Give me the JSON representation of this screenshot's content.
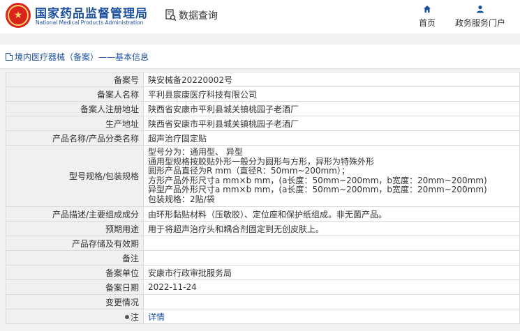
{
  "header": {
    "org_cn": "国家药品监督管理局",
    "org_en": "National Medical Products Administration",
    "query_label": "数据查询",
    "nav": [
      {
        "label": "首页",
        "icon": "home-icon"
      },
      {
        "label": "政务服务门户",
        "icon": "user-icon"
      }
    ]
  },
  "breadcrumb": "境内医疗器械（备案）——基本信息",
  "colors": {
    "brand": "#1b4f9c",
    "logo_red": "#d9231c"
  },
  "rows": [
    {
      "label": "备案号",
      "value": "陕安械备20220002号"
    },
    {
      "label": "备案人名称",
      "value": "平利县宸康医疗科技有限公司"
    },
    {
      "label": "备案人注册地址",
      "value": "陕西省安康市平利县城关镇桃园子老酒厂"
    },
    {
      "label": "生产地址",
      "value": "陕西省安康市平利县城关镇桃园子老酒厂"
    },
    {
      "label": "产品名称/产品分类名称",
      "value": "超声治疗固定贴"
    },
    {
      "label": "型号规格/包装规格",
      "lines": [
        "型号分为：通用型、 异型",
        "通用型规格按胶贴外形一般分为圆形与方形，异形为特殊外形",
        "圆形产品直径为R mm（直径R：50mm~200mm）；",
        "方形产品外形尺寸a mm×b mm，(a长度：50mm~200mm，b宽度：20mm~200mm)",
        "异型产品外形尺寸a mm×b mm，(a长度：50mm~200mm，b宽度：20mm~200mm)",
        "包装规格：2贴/袋"
      ]
    },
    {
      "label": "产品描述/主要组成成分",
      "value": "由环形黏贴材料（压敏胶）、定位座和保护纸组成。非无菌产品。"
    },
    {
      "label": "预期用途",
      "value": "用于将超声治疗头和耦合剂固定到无创皮肤上。"
    },
    {
      "label": "产品存储及有效期",
      "value": ""
    },
    {
      "label": "备注",
      "value": ""
    },
    {
      "label": "备案单位",
      "value": "安康市行政审批服务局"
    },
    {
      "label": "备案日期",
      "value": "2022-11-24"
    },
    {
      "label": "变更情况",
      "value": ""
    },
    {
      "label": "注",
      "value": "详情"
    }
  ]
}
